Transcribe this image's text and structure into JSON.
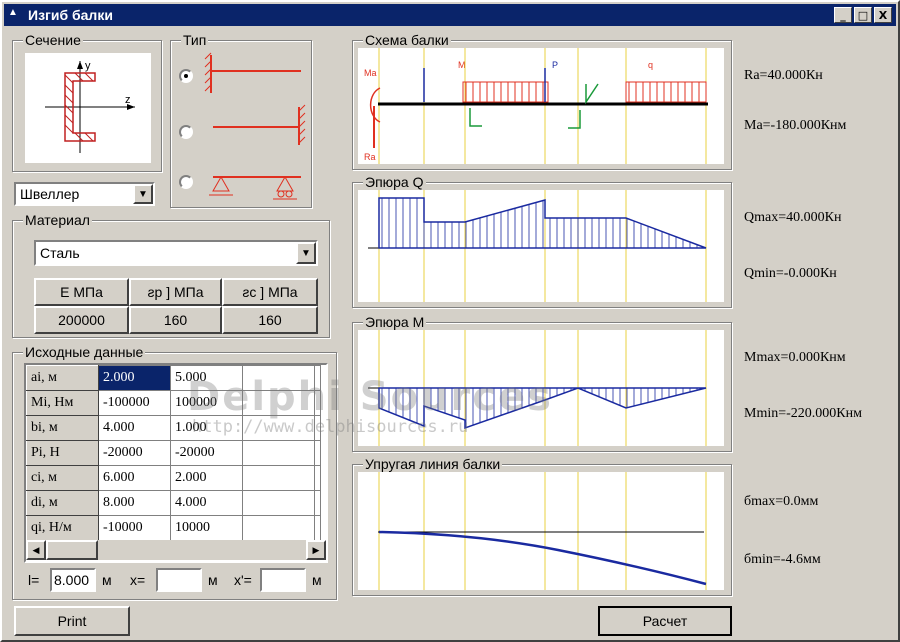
{
  "window": {
    "title": "Изгиб балки",
    "buttons": [
      "_",
      "□",
      "X"
    ]
  },
  "section": {
    "label": "Сечение",
    "axis_y": "y",
    "axis_z": "z",
    "profile": "Швеллер"
  },
  "type": {
    "label": "Тип",
    "selected": 0
  },
  "material": {
    "label": "Материал",
    "value": "Сталь",
    "headers": [
      "E МПа",
      "ƨр ] МПа",
      "ƨс ] МПа"
    ],
    "values": [
      "200000",
      "160",
      "160"
    ]
  },
  "input": {
    "label": "Исходные данные",
    "rows": [
      {
        "name": "ai, м",
        "v1": "2.000",
        "v2": "5.000"
      },
      {
        "name": "Mi, Нм",
        "v1": "-100000",
        "v2": "100000"
      },
      {
        "name": "bi, м",
        "v1": "4.000",
        "v2": "1.000"
      },
      {
        "name": "Pi, Н",
        "v1": "-20000",
        "v2": "-20000"
      },
      {
        "name": "ci, м",
        "v1": "6.000",
        "v2": "2.000"
      },
      {
        "name": "di, м",
        "v1": "8.000",
        "v2": "4.000"
      },
      {
        "name": "qi, Н/м",
        "v1": "-10000",
        "v2": "10000"
      }
    ]
  },
  "bottom_inputs": {
    "l_label": "l=",
    "l_value": "8.000",
    "unit": "м",
    "x_label": "x=",
    "x_value": "",
    "x2_label": "x'=",
    "x2_value": ""
  },
  "charts": {
    "scheme": {
      "label": "Схема балки",
      "ma": "Ma",
      "ra": "Ra",
      "m": "M",
      "p": "P",
      "q": "q"
    },
    "q": {
      "label": "Эпюра Q"
    },
    "m": {
      "label": "Эпюра M"
    },
    "elastic": {
      "label": "Упругая линия балки"
    }
  },
  "results": {
    "ra": "Ra=40.000Кн",
    "ma": "Ma=-180.000Кнм",
    "qmax": "Qmax=40.000Кн",
    "qmin": "Qmin=-0.000Кн",
    "mmax": "Mmax=0.000Кнм",
    "mmin": "Mmin=-220.000Кнм",
    "dmax": "бmax=0.0мм",
    "dmin": "бmin=-4.6мм"
  },
  "buttons": {
    "print": "Print",
    "calc": "Расчет"
  },
  "watermark": {
    "title": "Delphi Sources",
    "url": "http://www.delphisources.ru"
  },
  "colors": {
    "titlebar": "#0a246a",
    "red": "#e03020",
    "blue": "#1a2aa0",
    "green": "#1a9a3a",
    "yellow": "#e8d040"
  }
}
